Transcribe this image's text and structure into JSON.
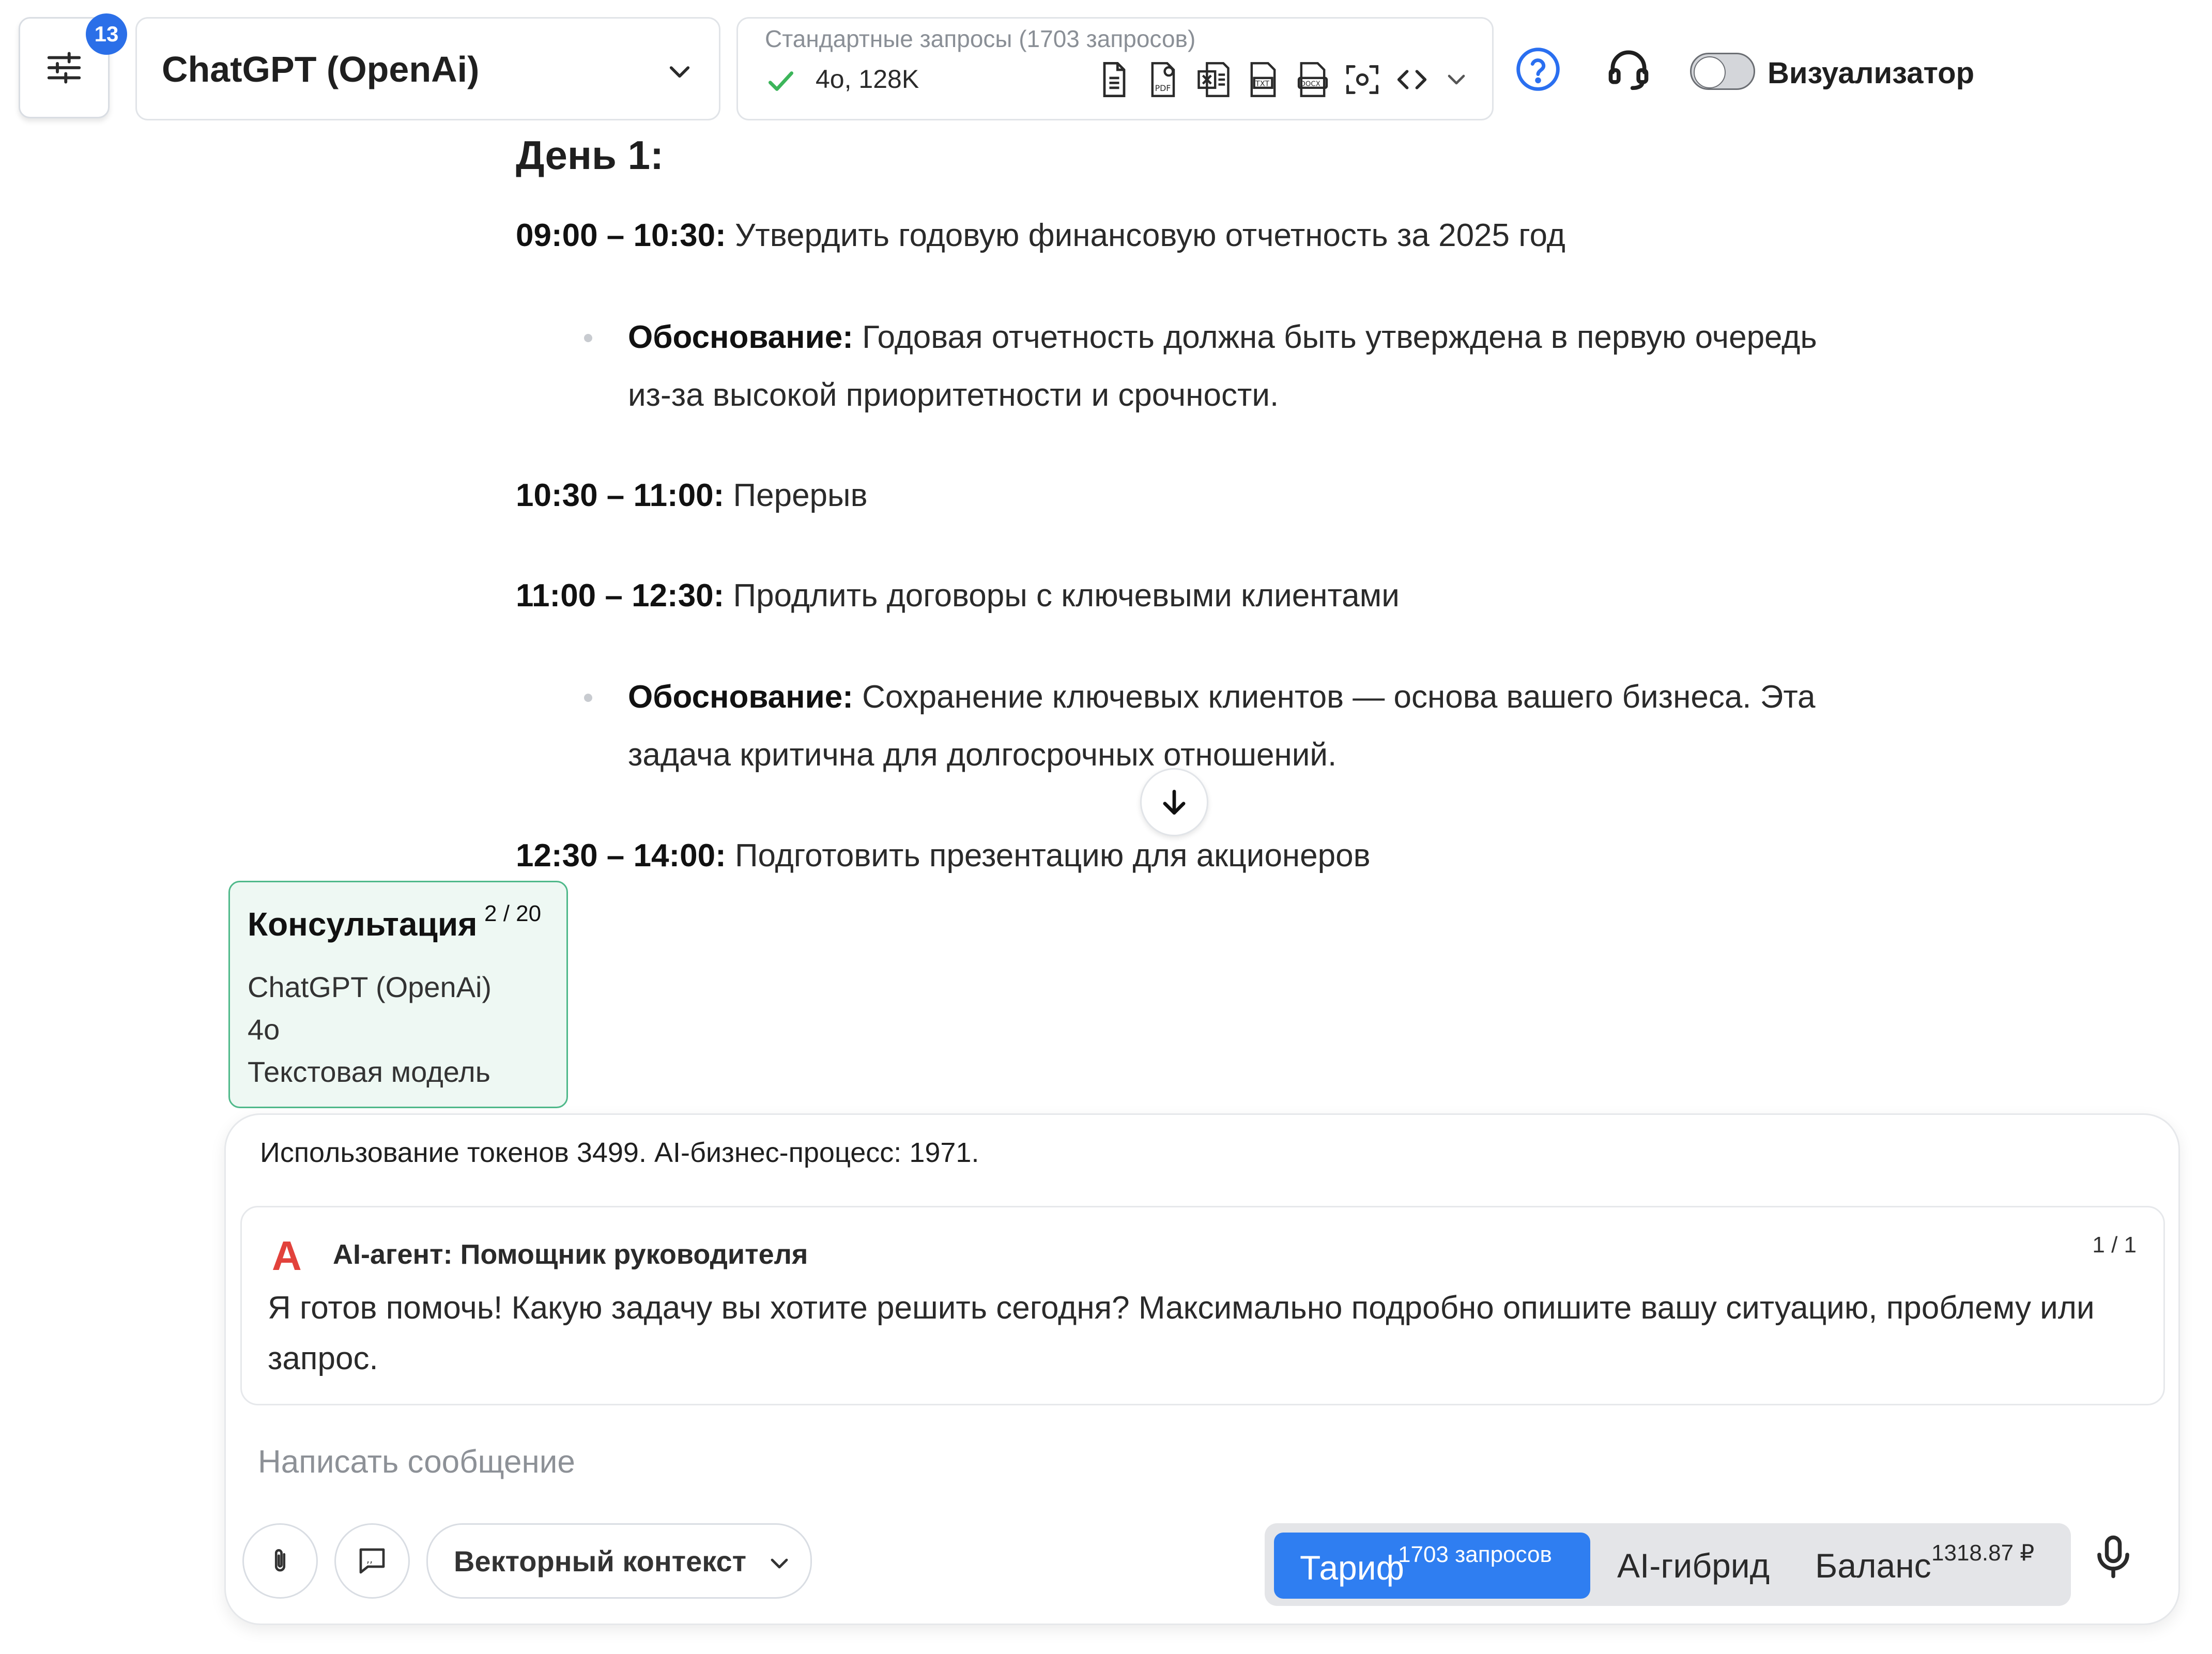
{
  "header": {
    "settings_badge": "13",
    "model_select": "ChatGPT (OpenAi)",
    "requests_title": "Стандартные запросы (1703 запросов)",
    "requests_model": "4o, 128K",
    "file_icons": [
      "document-icon",
      "pdf-icon",
      "excel-icon",
      "txt-icon",
      "docx-icon",
      "screenshot-icon",
      "code-icon",
      "chevron-down-icon"
    ],
    "visualizer_label": "Визуализатор",
    "visualizer_on": false
  },
  "content": {
    "day_heading": "День 1:",
    "items": [
      {
        "time": "09:00 – 10:30:",
        "text": " Утвердить годовую финансовую отчетность за 2025 год"
      },
      {
        "reason_label": "Обоснование:",
        "reason_line1": " Годовая отчетность должна быть утверждена в первую очередь",
        "reason_line2": "из-за высокой приоритетности и срочности."
      },
      {
        "time": "10:30 – 11:00:",
        "text": " Перерыв"
      },
      {
        "time": "11:00 – 12:30:",
        "text": " Продлить договоры с ключевыми клиентами"
      },
      {
        "reason_label": "Обоснование:",
        "reason_line1": " Сохранение ключевых клиентов — основа вашего бизнеса. Эта",
        "reason_line2": "задача критична для долгосрочных отношений."
      },
      {
        "time": "12:30 – 14:00:",
        "text": " Подготовить презентацию для акционеров"
      }
    ]
  },
  "consultation": {
    "title": "Консультация",
    "count": "2 / 20",
    "model": "ChatGPT (OpenAi)",
    "version": "4o",
    "type": "Текстовая модель"
  },
  "composer": {
    "tokens_text": "Использование токенов 3499. AI-бизнес-процесс: 1971.",
    "agent": {
      "logo": "A",
      "title": "AI-агент: Помощник руководителя",
      "page": "1 / 1",
      "message": "Я готов помочь! Какую задачу вы хотите решить сегодня? Максимально подробно опишите вашу ситуацию, проблему или запрос."
    },
    "input_placeholder": "Написать сообщение",
    "vector_context": "Векторный контекст",
    "modes": {
      "tarif": "Тариф",
      "tarif_sup": "1703 запросов",
      "hybrid": "AI-гибрид",
      "balance": "Баланс",
      "balance_sup": "1318.87 ₽"
    }
  },
  "colors": {
    "accent": "#2f7ef1",
    "badge": "#2b6fe8",
    "consult_bg": "#eef8f3",
    "consult_border": "#4fb98a",
    "agent_logo": "#e2423c"
  }
}
